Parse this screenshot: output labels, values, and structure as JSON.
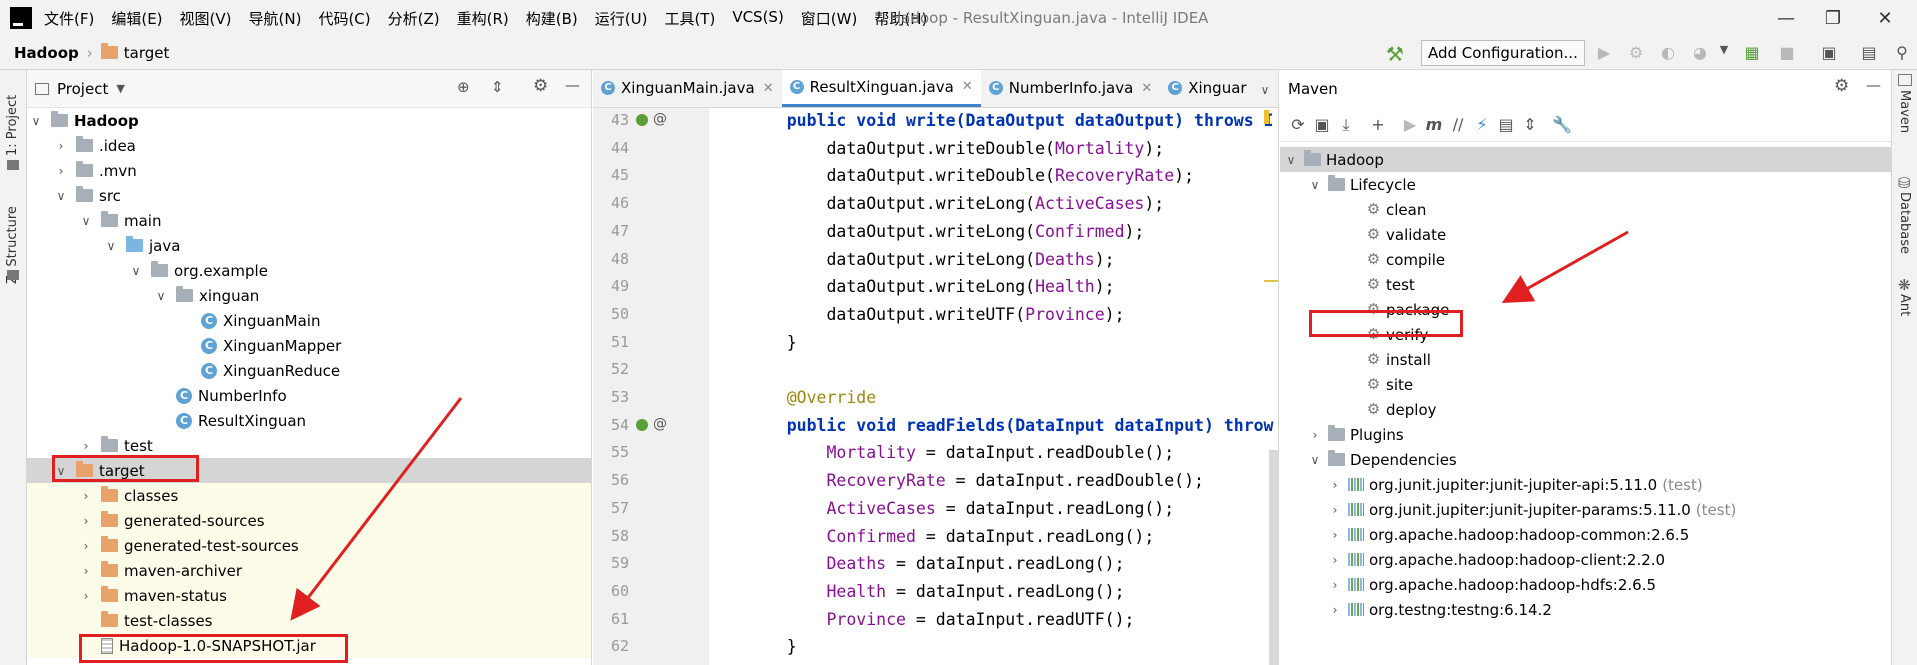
{
  "titlebar": {
    "menu": [
      "文件(F)",
      "编辑(E)",
      "视图(V)",
      "导航(N)",
      "代码(C)",
      "分析(Z)",
      "重构(R)",
      "构建(B)",
      "运行(U)",
      "工具(T)",
      "VCS(S)",
      "窗口(W)",
      "帮助(H)"
    ],
    "window_title": "Hadoop - ResultXinguan.java - IntelliJ IDEA"
  },
  "navbar": {
    "crumb_project": "Hadoop",
    "crumb_folder": "target",
    "add_configuration": "Add Configuration..."
  },
  "left_strip": {
    "project_tab": "1: Project",
    "structure_tab": "Z: Structure"
  },
  "right_strip": {
    "maven_tab": "Maven",
    "database_tab": "Database",
    "ant_tab": "Ant"
  },
  "project_panel": {
    "title": "Project",
    "tree": [
      {
        "label": "Hadoop",
        "depth": 0,
        "arrow": "open",
        "icon": "module",
        "bold": true
      },
      {
        "label": ".idea",
        "depth": 1,
        "arrow": "closed",
        "icon": "folder-gray"
      },
      {
        "label": ".mvn",
        "depth": 1,
        "arrow": "closed",
        "icon": "folder-gray"
      },
      {
        "label": "src",
        "depth": 1,
        "arrow": "open",
        "icon": "folder-gray"
      },
      {
        "label": "main",
        "depth": 2,
        "arrow": "open",
        "icon": "folder-gray"
      },
      {
        "label": "java",
        "depth": 3,
        "arrow": "open",
        "icon": "folder-blue"
      },
      {
        "label": "org.example",
        "depth": 4,
        "arrow": "open",
        "icon": "package"
      },
      {
        "label": "xinguan",
        "depth": 5,
        "arrow": "open",
        "icon": "package"
      },
      {
        "label": "XinguanMain",
        "depth": 6,
        "arrow": "none",
        "icon": "class-run"
      },
      {
        "label": "XinguanMapper",
        "depth": 6,
        "arrow": "none",
        "icon": "class"
      },
      {
        "label": "XinguanReduce",
        "depth": 6,
        "arrow": "none",
        "icon": "class"
      },
      {
        "label": "NumberInfo",
        "depth": 5,
        "arrow": "none",
        "icon": "class"
      },
      {
        "label": "ResultXinguan",
        "depth": 5,
        "arrow": "none",
        "icon": "class"
      },
      {
        "label": "test",
        "depth": 2,
        "arrow": "closed",
        "icon": "folder-gray"
      },
      {
        "label": "target",
        "depth": 1,
        "arrow": "open",
        "icon": "folder",
        "selected": true
      },
      {
        "label": "classes",
        "depth": 2,
        "arrow": "closed",
        "icon": "folder",
        "excluded": true
      },
      {
        "label": "generated-sources",
        "depth": 2,
        "arrow": "closed",
        "icon": "folder",
        "excluded": true
      },
      {
        "label": "generated-test-sources",
        "depth": 2,
        "arrow": "closed",
        "icon": "folder",
        "excluded": true
      },
      {
        "label": "maven-archiver",
        "depth": 2,
        "arrow": "closed",
        "icon": "folder",
        "excluded": true
      },
      {
        "label": "maven-status",
        "depth": 2,
        "arrow": "closed",
        "icon": "folder",
        "excluded": true
      },
      {
        "label": "test-classes",
        "depth": 2,
        "arrow": "none",
        "icon": "folder",
        "excluded": true
      },
      {
        "label": "Hadoop-1.0-SNAPSHOT.jar",
        "depth": 2,
        "arrow": "none",
        "icon": "jar",
        "excluded": true
      }
    ]
  },
  "editor": {
    "tabs": [
      {
        "label": "XinguanMain.java",
        "active": false
      },
      {
        "label": "ResultXinguan.java",
        "active": true
      },
      {
        "label": "NumberInfo.java",
        "active": false
      },
      {
        "label": "Xinguar",
        "active": false
      }
    ],
    "lines": [
      {
        "n": "43",
        "html_kind": "sig1",
        "text": "    public void write(DataOutput dataOutput) throws I"
      },
      {
        "n": "44",
        "text": "        dataOutput.writeDouble(",
        "field": "Mortality",
        "tail": ");"
      },
      {
        "n": "45",
        "text": "        dataOutput.writeDouble(",
        "field": "RecoveryRate",
        "tail": ");"
      },
      {
        "n": "46",
        "text": "        dataOutput.writeLong(",
        "field": "ActiveCases",
        "tail": ");"
      },
      {
        "n": "47",
        "text": "        dataOutput.writeLong(",
        "field": "Confirmed",
        "tail": ");"
      },
      {
        "n": "48",
        "text": "        dataOutput.writeLong(",
        "field": "Deaths",
        "tail": ");"
      },
      {
        "n": "49",
        "text": "        dataOutput.writeLong(",
        "field": "Health",
        "tail": ");"
      },
      {
        "n": "50",
        "text": "        dataOutput.writeUTF(",
        "field": "Province",
        "tail": ");"
      },
      {
        "n": "51",
        "text": "    }"
      },
      {
        "n": "52",
        "text": ""
      },
      {
        "n": "53",
        "html_kind": "ann",
        "text": "    @Override"
      },
      {
        "n": "54",
        "html_kind": "sig2",
        "text": "    public void readFields(DataInput dataInput) throw"
      },
      {
        "n": "55",
        "lead": "        ",
        "field": "Mortality",
        "tail": " = dataInput.readDouble();"
      },
      {
        "n": "56",
        "lead": "        ",
        "field": "RecoveryRate",
        "tail": " = dataInput.readDouble();"
      },
      {
        "n": "57",
        "lead": "        ",
        "field": "ActiveCases",
        "tail": " = dataInput.readLong();"
      },
      {
        "n": "58",
        "lead": "        ",
        "field": "Confirmed",
        "tail": " = dataInput.readLong();"
      },
      {
        "n": "59",
        "lead": "        ",
        "field": "Deaths",
        "tail": " = dataInput.readLong();"
      },
      {
        "n": "60",
        "lead": "        ",
        "field": "Health",
        "tail": " = dataInput.readLong();"
      },
      {
        "n": "61",
        "lead": "        ",
        "field": "Province",
        "tail": " = dataInput.readUTF();"
      },
      {
        "n": "62",
        "text": "    }"
      }
    ]
  },
  "maven_panel": {
    "title": "Maven",
    "root": "Hadoop",
    "lifecycle_label": "Lifecycle",
    "lifecycle": [
      "clean",
      "validate",
      "compile",
      "test",
      "package",
      "verify",
      "install",
      "site",
      "deploy"
    ],
    "plugins_label": "Plugins",
    "dependencies_label": "Dependencies",
    "dependencies": [
      {
        "name": "org.junit.jupiter:junit-jupiter-api:5.11.0",
        "scope": "(test)"
      },
      {
        "name": "org.junit.jupiter:junit-jupiter-params:5.11.0",
        "scope": "(test)"
      },
      {
        "name": "org.apache.hadoop:hadoop-common:2.6.5",
        "scope": ""
      },
      {
        "name": "org.apache.hadoop:hadoop-client:2.2.0",
        "scope": ""
      },
      {
        "name": "org.apache.hadoop:hadoop-hdfs:2.6.5",
        "scope": ""
      },
      {
        "name": "org.testng:testng:6.14.2",
        "scope": ""
      }
    ]
  },
  "colors": {
    "highlight_red": "#e02020",
    "excluded_bg": "#fdfce8",
    "selected_bg": "#d5d5d5"
  }
}
